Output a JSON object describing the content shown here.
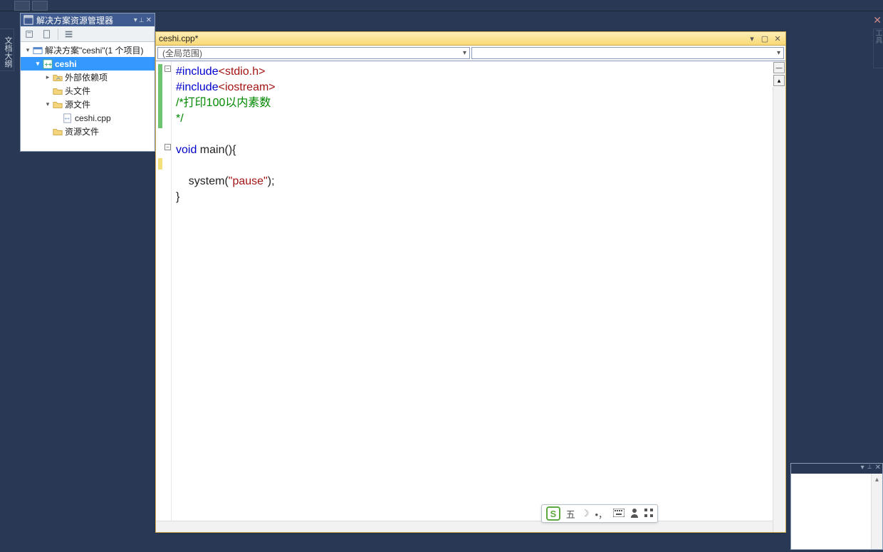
{
  "top_strip": {
    "btn1": "",
    "btn2": ""
  },
  "left_tab": {
    "label": "文档大纲"
  },
  "right_tab": {
    "label": "工具"
  },
  "solution_explorer": {
    "title": "解决方案资源管理器",
    "pin": "▾",
    "auto_hide": "📌",
    "close": "✕",
    "toolbar": {
      "home": "⌂",
      "refresh": "🗎",
      "props": "≡"
    },
    "solution_label": "解决方案\"ceshi\"(1 个项目)",
    "project": "ceshi",
    "ext_deps": "外部依赖项",
    "headers": "头文件",
    "sources": "源文件",
    "file_cpp": "ceshi.cpp",
    "resources": "资源文件"
  },
  "editor": {
    "tab_title": "ceshi.cpp*",
    "dropdown_left": "(全局范围)",
    "dropdown_right": "",
    "win": {
      "menu": "▾",
      "max": "▢",
      "close": "✕"
    },
    "split": {
      "h": "—",
      "up": "▴"
    },
    "fold": "−",
    "code": {
      "l1a": "#include",
      "l1b": "<stdio.h>",
      "l2a": "#include",
      "l2b": "<iostream>",
      "l3": "/*打印100以内素数",
      "l4": "*/",
      "l5": "",
      "l6a": "void",
      "l6b": " main(){",
      "l7": "",
      "l8a": "    system(",
      "l8b": "\"pause\"",
      "l8c": ");",
      "l9": "}"
    }
  },
  "ime": {
    "logo": "S",
    "wubi": "五",
    "moon": "☽",
    "punct": "•，",
    "kbd": "⌨",
    "user": "👤",
    "grid": "⠿"
  },
  "br_panel": {
    "drop": "▾",
    "pin": "📌",
    "close": "✕",
    "up": "▴"
  },
  "right_x": "✕"
}
